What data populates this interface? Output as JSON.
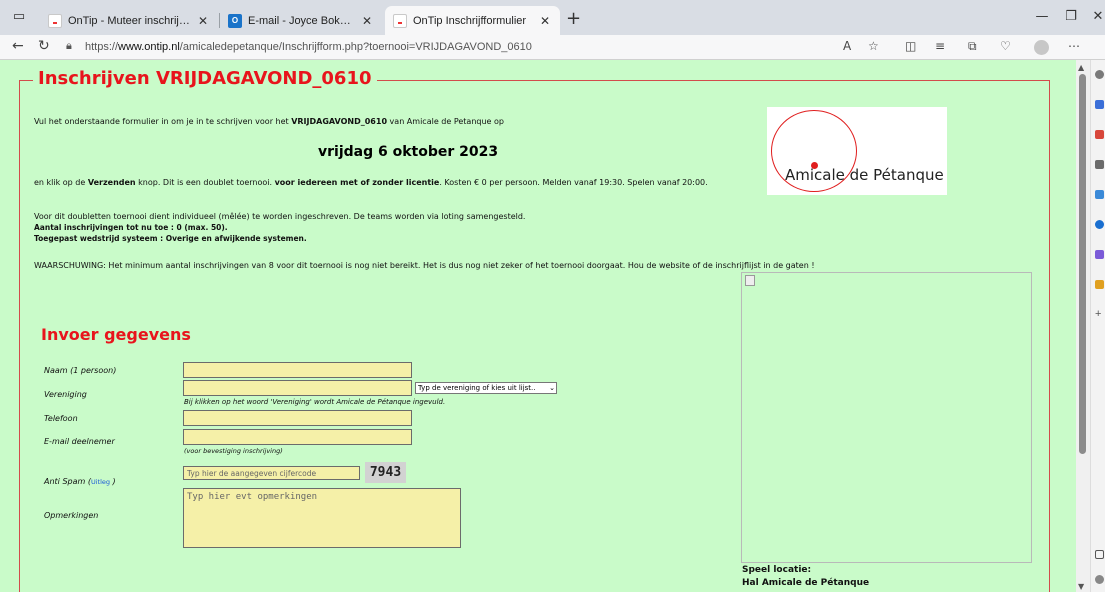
{
  "browser": {
    "tabs": [
      {
        "title": "OnTip - Muteer inschrijvingen",
        "icon": "ontip-favicon",
        "active": false
      },
      {
        "title": "E-mail - Joyce Bokhorst - Outloo",
        "icon": "outlook-favicon",
        "active": false
      },
      {
        "title": "OnTip Inschrijfformulier",
        "icon": "ontip-favicon",
        "active": true
      }
    ],
    "url_prefix": "https://",
    "url_domain": "www.ontip.nl",
    "url_path": "/amicaledepetanque/Inschrijfform.php?toernooi=VRIJDAGAVOND_0610"
  },
  "form": {
    "legend": "Inschrijven VRIJDAGAVOND_0610",
    "intro_pre": "Vul het onderstaande formulier in om je in te schrijven voor het ",
    "intro_bold": "VRIJDAGAVOND_0610",
    "intro_post": " van Amicale de Petanque op",
    "date_title": "vrijdag 6 oktober 2023",
    "line2_a": "en klik op de ",
    "line2_b": "Verzenden",
    "line2_c": " knop. Dit is een doublet toernooi. ",
    "line2_d": "voor iedereen met of zonder licentie",
    "line2_e": ". Kosten € 0 per persoon. Melden vanaf 19:30. Spelen vanaf 20:00.",
    "info1": "Voor dit doubletten toernooi dient individueel (mêlée) te worden ingeschreven. De teams worden via loting samengesteld.",
    "info2": "Aantal inschrijvingen tot nu toe : 0 (max. 50).",
    "info3": "Toegepast wedstrijd systeem : Overige en afwijkende systemen.",
    "warning": "WAARSCHUWING: Het minimum aantal inschrijvingen van 8 voor dit toernooi is nog niet bereikt. Het is dus nog niet zeker of het toernooi doorgaat. Hou de website of de inschrijflijst in de gaten !",
    "logo_text": "Amicale de Pétanque",
    "section_title": "Invoer gegevens",
    "fields": {
      "naam_label": "Naam (1 persoon)",
      "vereniging_label": "Vereniging",
      "vereniging_select": "Typ de vereniging of kies uit lijst..",
      "vereniging_hint": "Bij klikken op het woord 'Vereniging' wordt Amicale de Pétanque ingevuld.",
      "telefoon_label": "Telefoon",
      "email_label": "E-mail deelnemer",
      "email_hint": "(voor bevestiging inschrijving)",
      "antispam_label_pre": "Anti Spam (",
      "antispam_link": "Uitleg",
      "antispam_label_post": " )",
      "antispam_placeholder": "Typ hier de aangegeven cijfercode",
      "antispam_code": "7943",
      "opmerkingen_label": "Opmerkingen",
      "opmerkingen_placeholder": "Typ hier evt opmerkingen"
    },
    "speel_locatie_label": "Speel locatie:",
    "speel_locatie_value": "Hal Amicale de Pétanque"
  }
}
